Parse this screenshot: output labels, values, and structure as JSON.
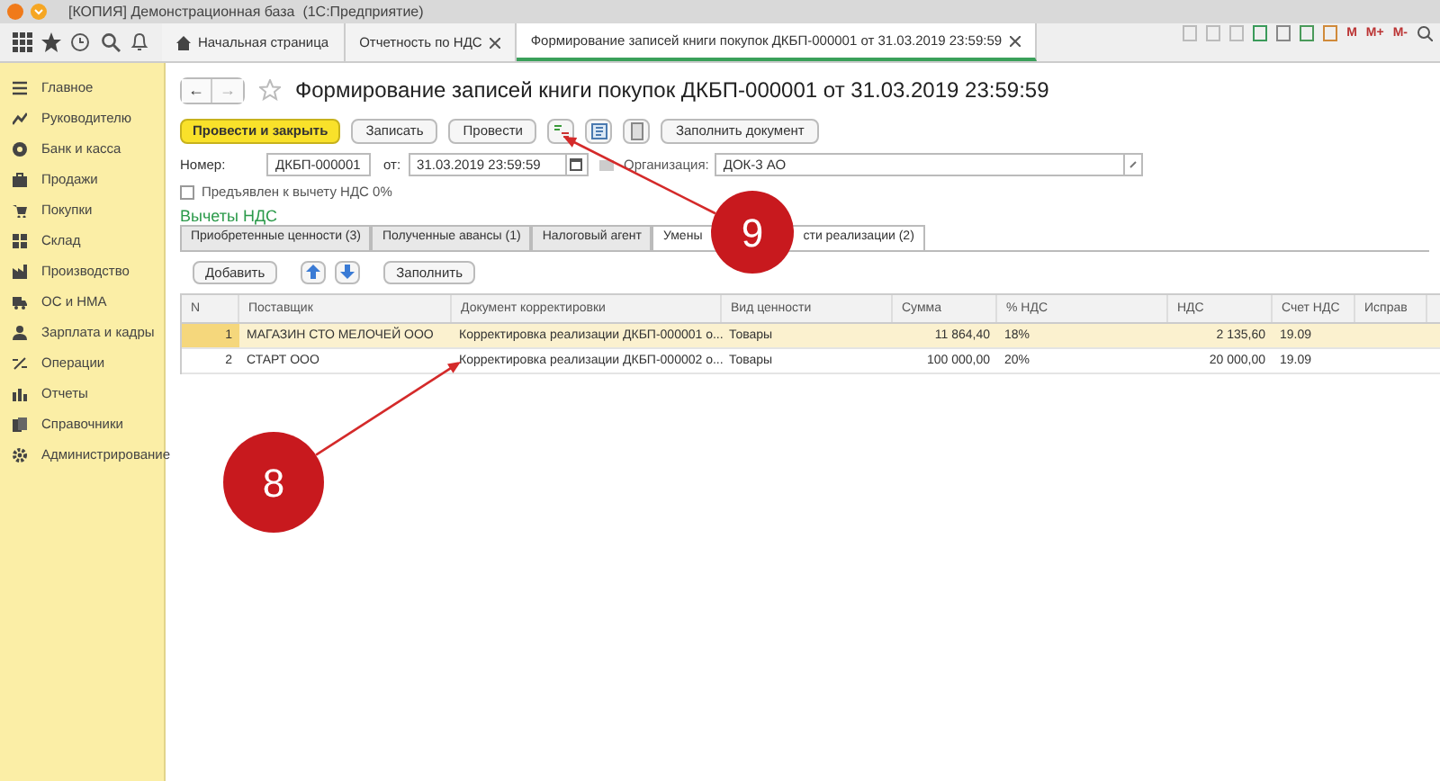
{
  "window": {
    "title": "[КОПИЯ] Демонстрационная база  (1С:Предприятие)",
    "memory_buttons": [
      "M",
      "M+",
      "M-"
    ]
  },
  "open_tabs": [
    {
      "kind": "home",
      "label": "Начальная страница",
      "selected": false,
      "closable": false
    },
    {
      "kind": "page",
      "label": "Отчетность по НДС",
      "selected": false,
      "closable": true
    },
    {
      "kind": "page",
      "label": "Формирование записей книги покупок ДКБП-000001 от 31.03.2019 23:59:59",
      "selected": true,
      "closable": true
    }
  ],
  "sidebar": {
    "items": [
      {
        "label": "Главное"
      },
      {
        "label": "Руководителю"
      },
      {
        "label": "Банк и касса"
      },
      {
        "label": "Продажи"
      },
      {
        "label": "Покупки"
      },
      {
        "label": "Склад"
      },
      {
        "label": "Производство"
      },
      {
        "label": "ОС и НМА"
      },
      {
        "label": "Зарплата и кадры"
      },
      {
        "label": "Операции"
      },
      {
        "label": "Отчеты"
      },
      {
        "label": "Справочники"
      },
      {
        "label": "Администрирование"
      }
    ]
  },
  "document": {
    "nav": [
      "←",
      "→"
    ],
    "title": "Формирование записей книги покупок ДКБП-000001 от 31.03.2019 23:59:59",
    "buttons": [
      {
        "kind": "primary",
        "label": "Провести и закрыть"
      },
      {
        "kind": "text",
        "label": "Записать"
      },
      {
        "kind": "text",
        "label": "Провести"
      },
      {
        "kind": "icon"
      },
      {
        "kind": "icon"
      },
      {
        "kind": "icon"
      },
      {
        "kind": "text",
        "label": "Заполнить документ"
      }
    ],
    "number": {
      "label": "Номер:",
      "value": "ДКБП-000001"
    },
    "date": {
      "label": "от:",
      "value": "31.03.2019 23:59:59"
    },
    "organization": {
      "label": "Организация:",
      "value": "ДОК-3 АО"
    },
    "vat_zero": {
      "label": "Предъявлен к вычету НДС 0%",
      "checked": false
    },
    "section_title": "Вычеты НДС",
    "tabs": [
      {
        "label": "Приобретенные ценности (3)",
        "selected": false
      },
      {
        "label": "Полученные авансы (1)",
        "selected": false
      },
      {
        "label": "Налоговый агент",
        "selected": false
      },
      {
        "label": "Умены",
        "label_tail": "сти реализации (2)",
        "selected": true
      }
    ],
    "table_buttons": [
      {
        "kind": "text",
        "label": "Добавить"
      },
      {
        "kind": "up"
      },
      {
        "kind": "down"
      },
      {
        "kind": "text",
        "label": "Заполнить"
      }
    ],
    "table": {
      "columns": [
        "N",
        "Поставщик",
        "Документ корректировки",
        "Вид ценности",
        "Сумма",
        "% НДС",
        "НДС",
        "Счет НДС",
        "Исправ"
      ],
      "rows": [
        {
          "selected": true,
          "cells": [
            "1",
            "МАГАЗИН СТО МЕЛОЧЕЙ ООО",
            "Корректировка реализации ДКБП-000001 о...",
            "Товары",
            "11 864,40",
            "18%",
            "2 135,60",
            "19.09",
            ""
          ]
        },
        {
          "selected": false,
          "cells": [
            "2",
            "СТАРТ ООО",
            "Корректировка реализации ДКБП-000002 о...",
            "Товары",
            "100 000,00",
            "20%",
            "20 000,00",
            "19.09",
            ""
          ]
        }
      ]
    }
  },
  "annotations": [
    {
      "label": "9"
    },
    {
      "label": "8"
    }
  ]
}
